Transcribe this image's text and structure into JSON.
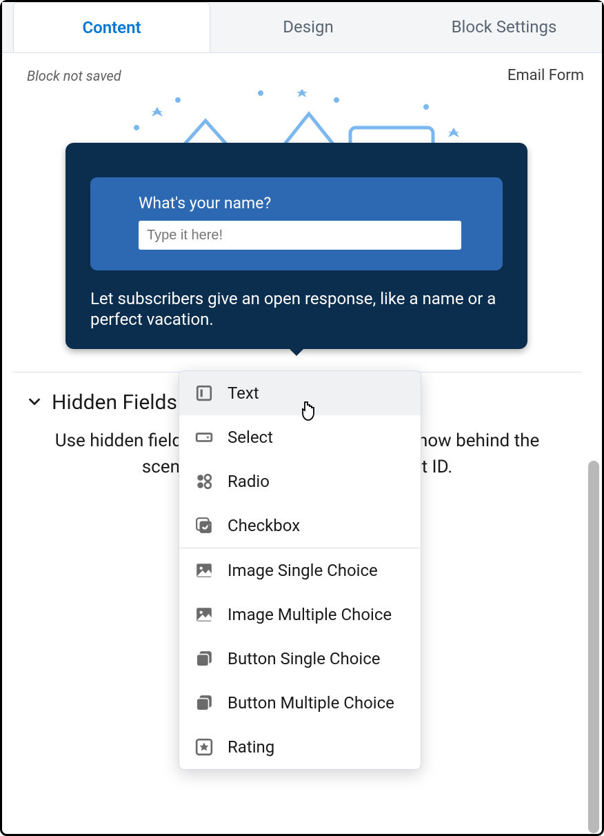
{
  "tabs": [
    {
      "label": "Content",
      "active": true
    },
    {
      "label": "Design",
      "active": false
    },
    {
      "label": "Block Settings",
      "active": false
    }
  ],
  "status": "Block not saved",
  "formType": "Email Form",
  "tooltip": {
    "question": "What's your name?",
    "placeholder": "Type it here!",
    "description": "Let subscribers give an open response, like a name or a perfect vacation."
  },
  "hiddenFields": {
    "title": "Hidden Fields",
    "description": "Use hidden fields to collect data you already know behind the scenes, like an account or a product ID."
  },
  "dropdown": {
    "groups": [
      [
        {
          "icon": "text",
          "label": "Text",
          "hover": true
        },
        {
          "icon": "select",
          "label": "Select"
        },
        {
          "icon": "radio",
          "label": "Radio"
        },
        {
          "icon": "checkbox",
          "label": "Checkbox"
        }
      ],
      [
        {
          "icon": "image",
          "label": "Image Single Choice"
        },
        {
          "icon": "image",
          "label": "Image Multiple Choice"
        },
        {
          "icon": "button",
          "label": "Button Single Choice"
        },
        {
          "icon": "button",
          "label": "Button Multiple Choice"
        },
        {
          "icon": "rating",
          "label": "Rating"
        }
      ]
    ]
  }
}
